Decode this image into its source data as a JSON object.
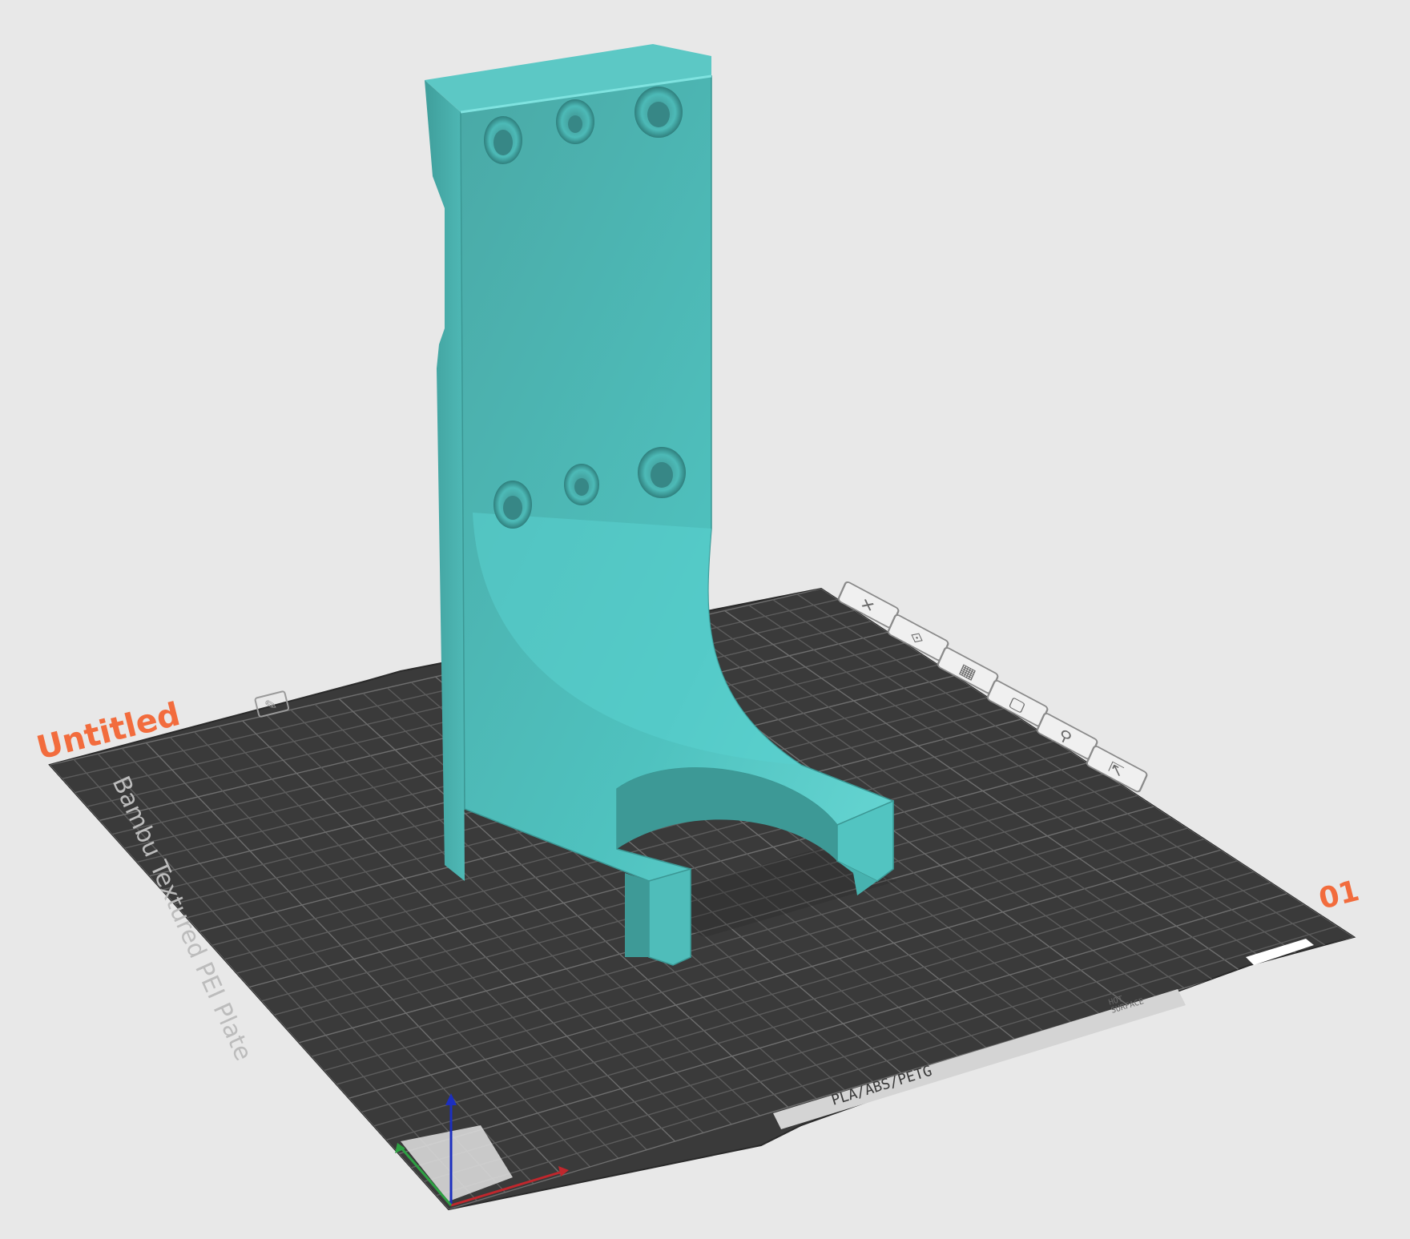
{
  "app": {
    "plate_name": "Untitled",
    "plate_number": "01"
  },
  "build_plate": {
    "type_text": "Bambu Textured PEI Plate",
    "filament_text": "PLA/ABS/PETG",
    "warning_text_line1": "HOT",
    "warning_text_line2": "SURFACE"
  },
  "plate_toolbar": {
    "icons": [
      {
        "name": "delete-plate-icon",
        "glyph": "✕"
      },
      {
        "name": "orient-plate-icon",
        "glyph": "⟐"
      },
      {
        "name": "arrange-plate-icon",
        "glyph": "▦"
      },
      {
        "name": "lock-plate-icon",
        "glyph": "▢"
      },
      {
        "name": "plate-settings-icon",
        "glyph": "⚲"
      },
      {
        "name": "move-plate-icon",
        "glyph": "⇱"
      }
    ]
  },
  "colors": {
    "background": "#e8e8e8",
    "plate": "#3a3a3a",
    "grid": "#5c5c5c",
    "model": "#4fc2bf",
    "model_shadow": "#3a9997",
    "accent_orange": "#f26c3d",
    "axis_x": "#c0272d",
    "axis_y": "#2ea043",
    "axis_z": "#1c2fbf"
  }
}
